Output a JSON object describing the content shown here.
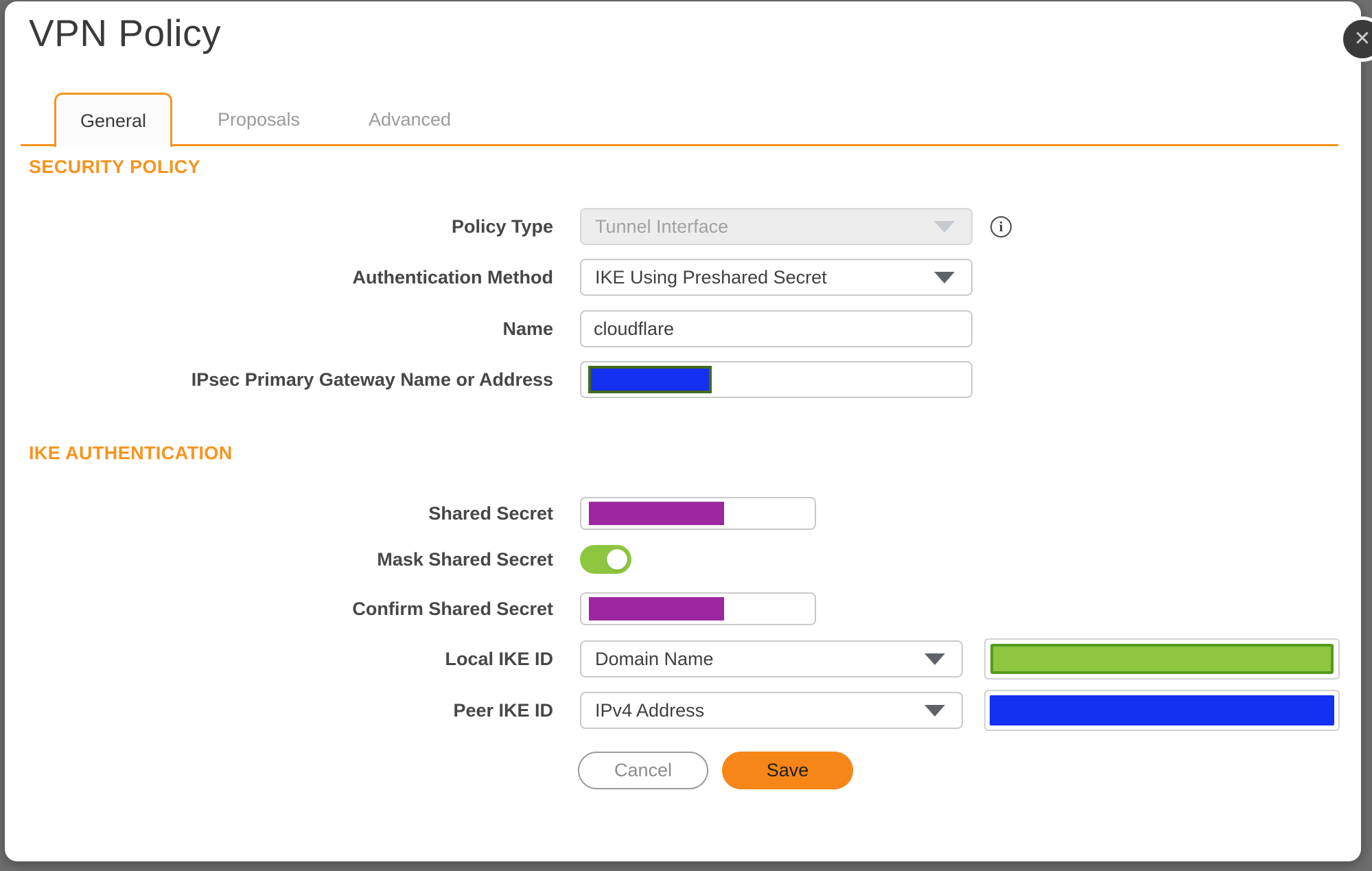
{
  "dialog": {
    "title": "VPN Policy",
    "close_glyph": "✕",
    "info_glyph": "i"
  },
  "tabs": [
    {
      "label": "General",
      "active": true
    },
    {
      "label": "Proposals",
      "active": false
    },
    {
      "label": "Advanced",
      "active": false
    }
  ],
  "sections": {
    "security_policy": {
      "heading": "SECURITY POLICY"
    },
    "ike_authentication": {
      "heading": "IKE AUTHENTICATION"
    }
  },
  "fields": {
    "policy_type": {
      "label": "Policy Type",
      "value": "Tunnel Interface",
      "disabled": true
    },
    "auth_method": {
      "label": "Authentication Method",
      "value": "IKE Using Preshared Secret"
    },
    "name": {
      "label": "Name",
      "value": "cloudflare"
    },
    "gateway": {
      "label": "IPsec Primary Gateway Name or Address",
      "value_redacted": true
    },
    "shared_secret": {
      "label": "Shared Secret",
      "value_redacted": true
    },
    "mask_shared_secret": {
      "label": "Mask Shared Secret",
      "on": true
    },
    "confirm_shared_secret": {
      "label": "Confirm Shared Secret",
      "value_redacted": true
    },
    "local_ike_id": {
      "label": "Local IKE ID",
      "value": "Domain Name",
      "id_value_redacted": true
    },
    "peer_ike_id": {
      "label": "Peer IKE ID",
      "value": "IPv4 Address",
      "id_value_redacted": true
    }
  },
  "buttons": {
    "cancel": "Cancel",
    "save": "Save"
  },
  "colors": {
    "accent_orange": "#F7941E",
    "save_orange": "#F68617",
    "toggle_on": "#8CC63E",
    "redact_purple": "#9C27A0",
    "redact_green_fill": "#8DC63F",
    "redact_green_border": "#569A1F",
    "redact_blue": "#1430F0",
    "redact_olive_border": "#456A1E",
    "backdrop": "#6E6E6E"
  }
}
